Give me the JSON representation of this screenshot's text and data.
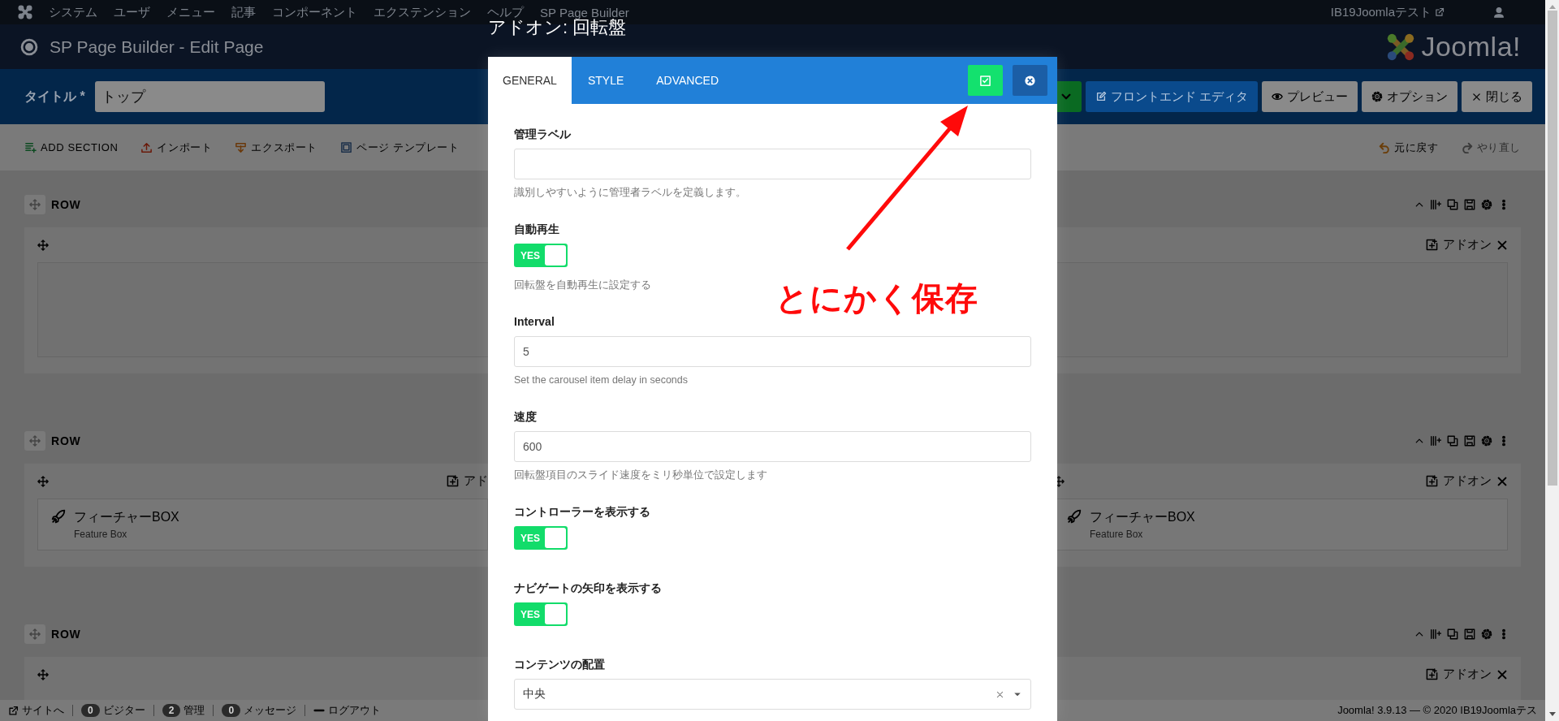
{
  "top_nav": {
    "menu": [
      "システム",
      "ユーザ",
      "メニュー",
      "記事",
      "コンポーネント",
      "エクステンション",
      "ヘルプ",
      "SP Page Builder"
    ],
    "site_name": "IB19Joomlaテスト"
  },
  "header": {
    "title": "SP Page Builder - Edit Page",
    "logo_text": "Joomla!"
  },
  "title_bar": {
    "label": "タイトル",
    "required_mark": "*",
    "value": "トップ",
    "buttons": [
      {
        "label": "フロントエンド エディタ",
        "kind": "primary"
      },
      {
        "label": "プレビュー",
        "kind": "default"
      },
      {
        "label": "オプション",
        "kind": "default"
      },
      {
        "label": "閉じる",
        "kind": "default"
      }
    ]
  },
  "toolbar": {
    "left": [
      {
        "label": "ADD SECTION"
      },
      {
        "label": "インポート"
      },
      {
        "label": "エクスポート"
      },
      {
        "label": "ページ テンプレート"
      }
    ],
    "right": [
      {
        "label": "元に戻す",
        "disabled": false
      },
      {
        "label": "やり直し",
        "disabled": true
      }
    ]
  },
  "rows": [
    {
      "label": "ROW",
      "columns": [
        {
          "addon_label": "アドオン",
          "empty": true
        }
      ]
    },
    {
      "label": "ROW",
      "columns": [
        {
          "addon_label": "アド",
          "addons": [
            {
              "title": "フィーチャーBOX",
              "subtitle": "Feature Box"
            }
          ]
        },
        {
          "addon_label": "アドオン",
          "addons": [
            {
              "title": "フィーチャーBOX",
              "subtitle": "Feature Box"
            }
          ]
        }
      ]
    },
    {
      "label": "ROW",
      "columns": [
        {
          "addon_label": "アドオン"
        }
      ]
    }
  ],
  "status_bar": {
    "items": [
      {
        "kind": "site",
        "label": "サイトへ"
      },
      {
        "kind": "count",
        "count": "0",
        "label": "ビジター"
      },
      {
        "kind": "count",
        "count": "2",
        "label": "管理"
      },
      {
        "kind": "count",
        "count": "0",
        "label": "メッセージ"
      },
      {
        "kind": "logout",
        "label": "ログアウト"
      }
    ],
    "copyright": "Joomla! 3.9.13 — © 2020 IB19Joomlaテス"
  },
  "modal": {
    "title": "アドオン: 回転盤",
    "tabs": [
      {
        "label": "GENERAL",
        "selected": true
      },
      {
        "label": "STYLE",
        "selected": false
      },
      {
        "label": "ADVANCED",
        "selected": false
      }
    ],
    "fields": [
      {
        "kind": "text",
        "label": "管理ラベル",
        "help": "識別しやすいように管理者ラベルを定義します。"
      },
      {
        "kind": "toggle",
        "label": "自動再生",
        "on": true,
        "text": "YES",
        "help": "回転盤を自動再生に設定する"
      },
      {
        "kind": "text",
        "label": "Interval",
        "value": "5",
        "help": "Set the carousel item delay in seconds"
      },
      {
        "kind": "text",
        "label": "速度",
        "value": "600",
        "help": "回転盤項目のスライド速度をミリ秒単位で設定します"
      },
      {
        "kind": "toggle",
        "label": "コントローラーを表示する",
        "on": true,
        "text": "YES"
      },
      {
        "kind": "toggle",
        "label": "ナビゲートの矢印を表示する",
        "on": true,
        "text": "YES"
      },
      {
        "kind": "select",
        "label": "コンテンツの配置",
        "value": "中央"
      }
    ]
  },
  "annotation": {
    "text": "とにかく保存"
  }
}
